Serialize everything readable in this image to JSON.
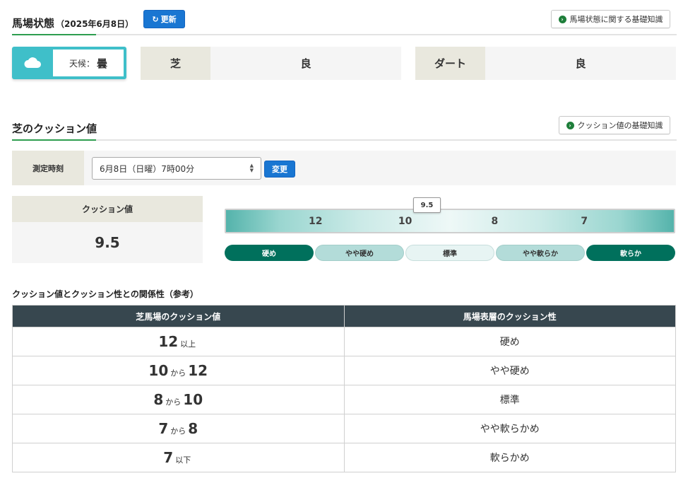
{
  "status": {
    "title": "馬場状態",
    "date": "（2025年6月8日）",
    "refresh_label": "更新",
    "knowledge_label": "馬場状態に関する基礎知識",
    "weather_prefix": "天候：",
    "weather_value": "曇",
    "turf_label": "芝",
    "turf_value": "良",
    "dirt_label": "ダート",
    "dirt_value": "良"
  },
  "cushion": {
    "title": "芝のクッション値",
    "knowledge_label": "クッション値の基礎知識",
    "measure_label": "測定時刻",
    "measure_selected": "6月8日（日曜）7時00分",
    "change_label": "変更",
    "value_header": "クッション値",
    "value": "9.5",
    "gauge": {
      "current": 9.5,
      "marker_label": "9.5",
      "ticks": [
        "12",
        "10",
        "8",
        "7"
      ]
    },
    "categories": [
      "硬め",
      "やや硬め",
      "標準",
      "やや軟らか",
      "軟らか"
    ]
  },
  "relation": {
    "title": "クッション値とクッション性との関係性（参考）",
    "headers": [
      "芝馬場のクッション値",
      "馬場表層のクッション性"
    ],
    "rows": [
      {
        "a": "12",
        "sep": "以上",
        "b": "",
        "desc": "硬め"
      },
      {
        "a": "10",
        "sep": "から",
        "b": "12",
        "desc": "やや硬め"
      },
      {
        "a": "8",
        "sep": "から",
        "b": "10",
        "desc": "標準"
      },
      {
        "a": "7",
        "sep": "から",
        "b": "8",
        "desc": "やや軟らかめ"
      },
      {
        "a": "7",
        "sep": "以下",
        "b": "",
        "desc": "軟らかめ"
      }
    ]
  },
  "colors": {
    "accent_green": "#2e9e4f",
    "button_blue": "#1976d2",
    "weather_teal": "#3fbfc9",
    "table_header": "#37474f",
    "gauge_dark": "#00705c"
  }
}
